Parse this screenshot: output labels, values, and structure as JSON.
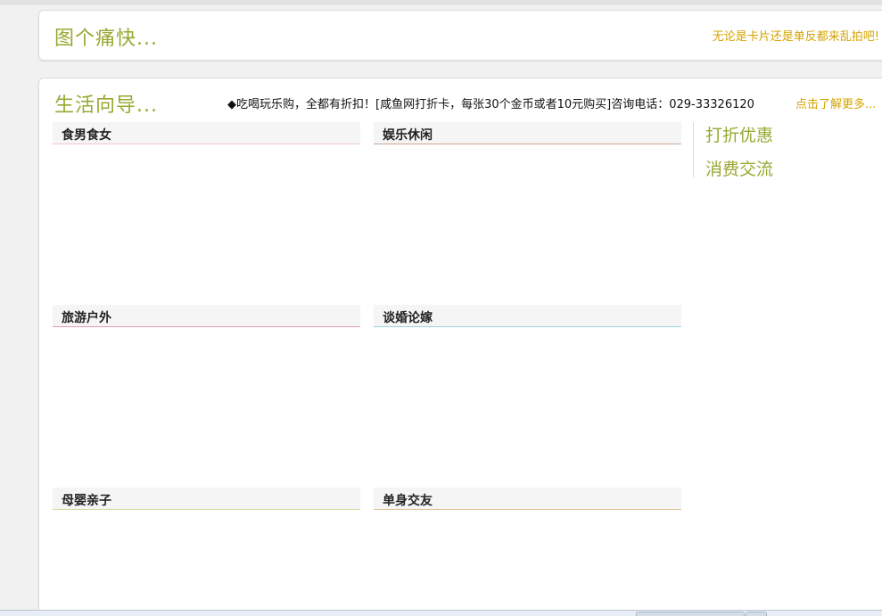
{
  "header_card": {
    "title": "图个痛快...",
    "slogan": "无论是卡片还是单反都来乱拍吧!"
  },
  "guide_card": {
    "title": "生活向导...",
    "notice": "◆吃喝玩乐购，全都有折扣！[咸鱼网打折卡，每张30个金币或者10元购买]咨询电话：029-33326120",
    "more_link": "点击了解更多..."
  },
  "categories": [
    {
      "label": "食男食女",
      "color": "#f2c4c4"
    },
    {
      "label": "娱乐休闲",
      "color": "#c9a898"
    },
    {
      "label": "旅游户外",
      "color": "#e79bbd"
    },
    {
      "label": "谈婚论嫁",
      "color": "#9bd3de"
    },
    {
      "label": "母婴亲子",
      "color": "#d4dca0"
    },
    {
      "label": "单身交友",
      "color": "#dcc391"
    }
  ],
  "side_links": [
    {
      "label": "打折优惠"
    },
    {
      "label": "消费交流"
    }
  ],
  "colors": {
    "accent_green": "#99a832",
    "accent_gold": "#d4a400"
  }
}
